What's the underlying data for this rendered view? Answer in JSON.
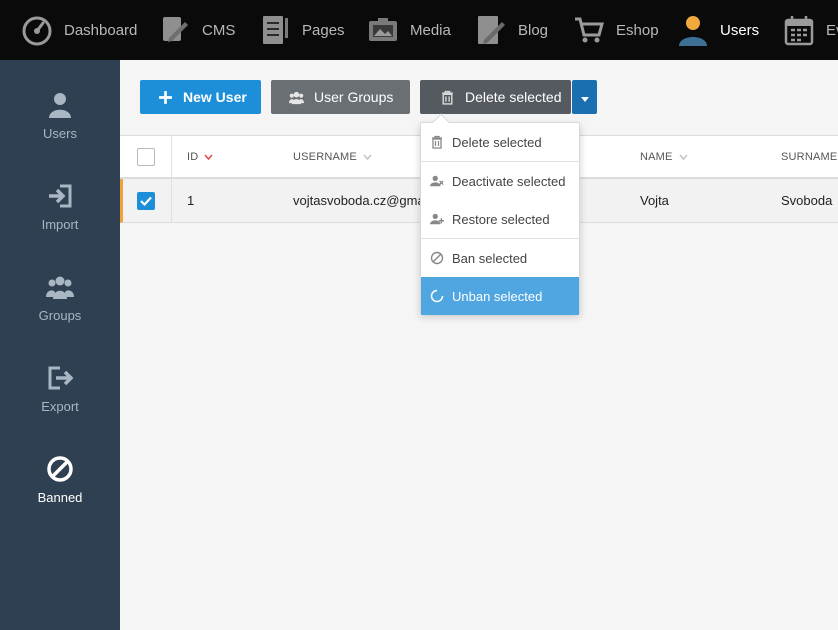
{
  "topnav": {
    "items": [
      {
        "label": "Dashboard",
        "icon": "gauge-icon"
      },
      {
        "label": "CMS",
        "icon": "cms-icon"
      },
      {
        "label": "Pages",
        "icon": "pages-icon"
      },
      {
        "label": "Media",
        "icon": "media-icon"
      },
      {
        "label": "Blog",
        "icon": "blog-icon"
      },
      {
        "label": "Eshop",
        "icon": "cart-icon"
      },
      {
        "label": "Users",
        "icon": "user-icon",
        "active": true
      },
      {
        "label": "Ev",
        "icon": "calendar-icon"
      }
    ]
  },
  "sidebar": {
    "items": [
      {
        "label": "Users",
        "icon": "user-icon"
      },
      {
        "label": "Import",
        "icon": "import-icon"
      },
      {
        "label": "Groups",
        "icon": "groups-icon"
      },
      {
        "label": "Export",
        "icon": "export-icon"
      },
      {
        "label": "Banned",
        "icon": "ban-icon",
        "active": true
      }
    ]
  },
  "toolbar": {
    "new_user": "New User",
    "user_groups": "User Groups",
    "delete_selected": "Delete selected"
  },
  "dropdown": {
    "items": [
      {
        "label": "Delete selected",
        "icon": "trash-icon"
      },
      {
        "label": "Deactivate selected",
        "icon": "user-times-icon"
      },
      {
        "label": "Restore selected",
        "icon": "user-plus-icon"
      },
      {
        "label": "Ban selected",
        "icon": "ban-icon"
      },
      {
        "label": "Unban selected",
        "icon": "circle-notch-icon",
        "highlighted": true
      }
    ]
  },
  "table": {
    "headers": {
      "id": "ID",
      "username": "USERNAME",
      "name": "NAME",
      "surname": "SURNAME"
    },
    "rows": [
      {
        "id": "1",
        "username": "vojtasvoboda.cz@gma",
        "name": "Vojta",
        "surname": "Svoboda",
        "checked": true
      }
    ]
  },
  "colors": {
    "topbar": "#0a0a0a",
    "sidebar": "#2f4052",
    "primary": "#1d8fd8",
    "highlight": "#4fa6e0",
    "row_accent": "#f0a33a",
    "user_avatar_accent": "#f2a93b"
  }
}
